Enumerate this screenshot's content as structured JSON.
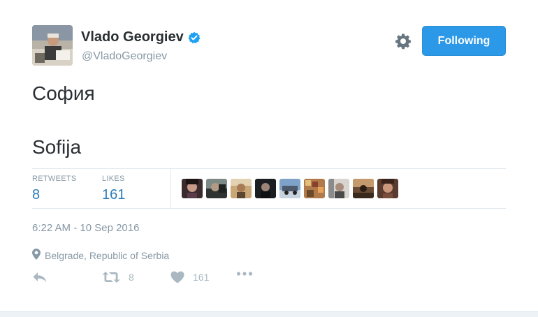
{
  "author": {
    "name": "Vlado Georgiev",
    "handle": "@VladoGeorgiev",
    "verified": true,
    "avatar_icon": "profile-photo"
  },
  "header": {
    "settings_icon": "gear-icon",
    "follow_label": "Following"
  },
  "tweet": {
    "lines": [
      "София",
      "Sofija"
    ]
  },
  "stats": {
    "retweets_label": "RETWEETS",
    "retweets": "8",
    "likes_label": "LIKES",
    "likes": "161"
  },
  "likers_count_shown": 9,
  "meta": {
    "timestamp": "6:22 AM - 10 Sep 2016",
    "location": "Belgrade, Republic of Serbia"
  },
  "actions": {
    "reply_icon": "reply-icon",
    "retweet_icon": "retweet-icon",
    "retweet_count": "8",
    "like_icon": "heart-icon",
    "like_count": "161",
    "more_icon": "more-icon"
  },
  "colors": {
    "accent": "#2b99e8",
    "link": "#2b7bb9",
    "muted": "#8899a6",
    "text": "#292f33",
    "icon": "#aab8c2"
  }
}
